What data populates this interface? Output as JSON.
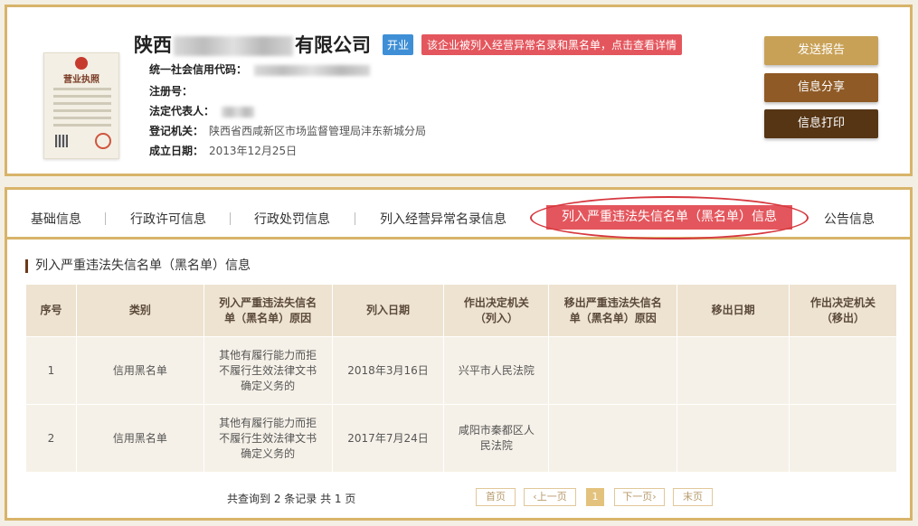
{
  "company": {
    "name_prefix": "陕西",
    "name_suffix": "有限公司",
    "status_badge": "开业",
    "warning_badge": "该企业被列入经营异常名录和黑名单，点击查看详情",
    "license_title": "营业执照"
  },
  "info": {
    "credit_code_label": "统一社会信用代码：",
    "reg_no_label": "注册号：",
    "legal_rep_label": "法定代表人：",
    "authority_label": "登记机关：",
    "authority_value": "陕西省西咸新区市场监督管理局沣东新城分局",
    "established_label": "成立日期：",
    "established_value": "2013年12月25日"
  },
  "actions": {
    "send": "发送报告",
    "share": "信息分享",
    "print": "信息打印"
  },
  "tabs": {
    "basic": "基础信息",
    "permit": "行政许可信息",
    "penalty": "行政处罚信息",
    "abnormal": "列入经营异常名录信息",
    "blacklist": "列入严重违法失信名单（黑名单）信息",
    "notice": "公告信息"
  },
  "section_title": "列入严重违法失信名单（黑名单）信息",
  "table": {
    "headers": [
      "序号",
      "类别",
      "列入严重违法失信名单（黑名单）原因",
      "列入日期",
      "作出决定机关（列入）",
      "移出严重违法失信名单（黑名单）原因",
      "移出日期",
      "作出决定机关（移出）"
    ],
    "rows": [
      [
        "1",
        "信用黑名单",
        "其他有履行能力而拒不履行生效法律文书确定义务的",
        "2018年3月16日",
        "兴平市人民法院",
        "",
        "",
        ""
      ],
      [
        "2",
        "信用黑名单",
        "其他有履行能力而拒不履行生效法律文书确定义务的",
        "2017年7月24日",
        "咸阳市秦都区人民法院",
        "",
        "",
        ""
      ]
    ]
  },
  "pager": {
    "summary": "共查询到 2 条记录 共 1 页",
    "first": "首页",
    "prev": "‹上一页",
    "current": "1",
    "next": "下一页›",
    "last": "末页"
  }
}
